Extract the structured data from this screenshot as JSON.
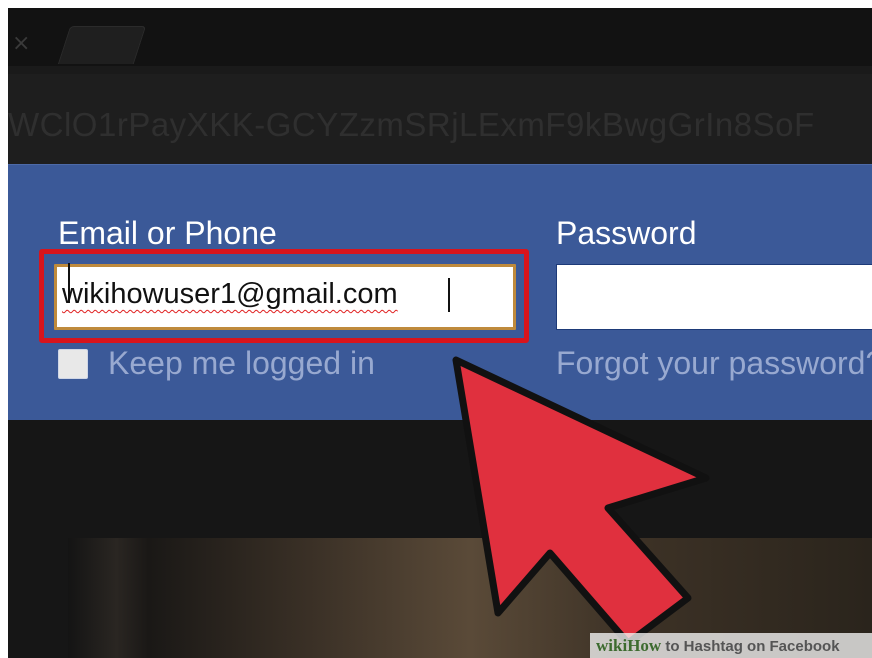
{
  "browser": {
    "close_glyph": "×",
    "url": "WClO1rPayXKK-GCYZzmSRjLExmF9kBwgGrIn8SoF"
  },
  "login": {
    "email_label": "Email or Phone",
    "email_value": "wikihowuser1@gmail.com",
    "password_label": "Password",
    "password_value": "",
    "keep_logged_in_label": "Keep me logged in",
    "keep_logged_in_checked": false,
    "forgot_label": "Forgot your password?"
  },
  "colors": {
    "facebook_blue": "#3b5998",
    "highlight_red": "#d8141c",
    "arrow_red": "#e0303e"
  },
  "watermark": {
    "brand_wiki": "wiki",
    "brand_how": "How",
    "title": " to Hashtag on Facebook"
  }
}
